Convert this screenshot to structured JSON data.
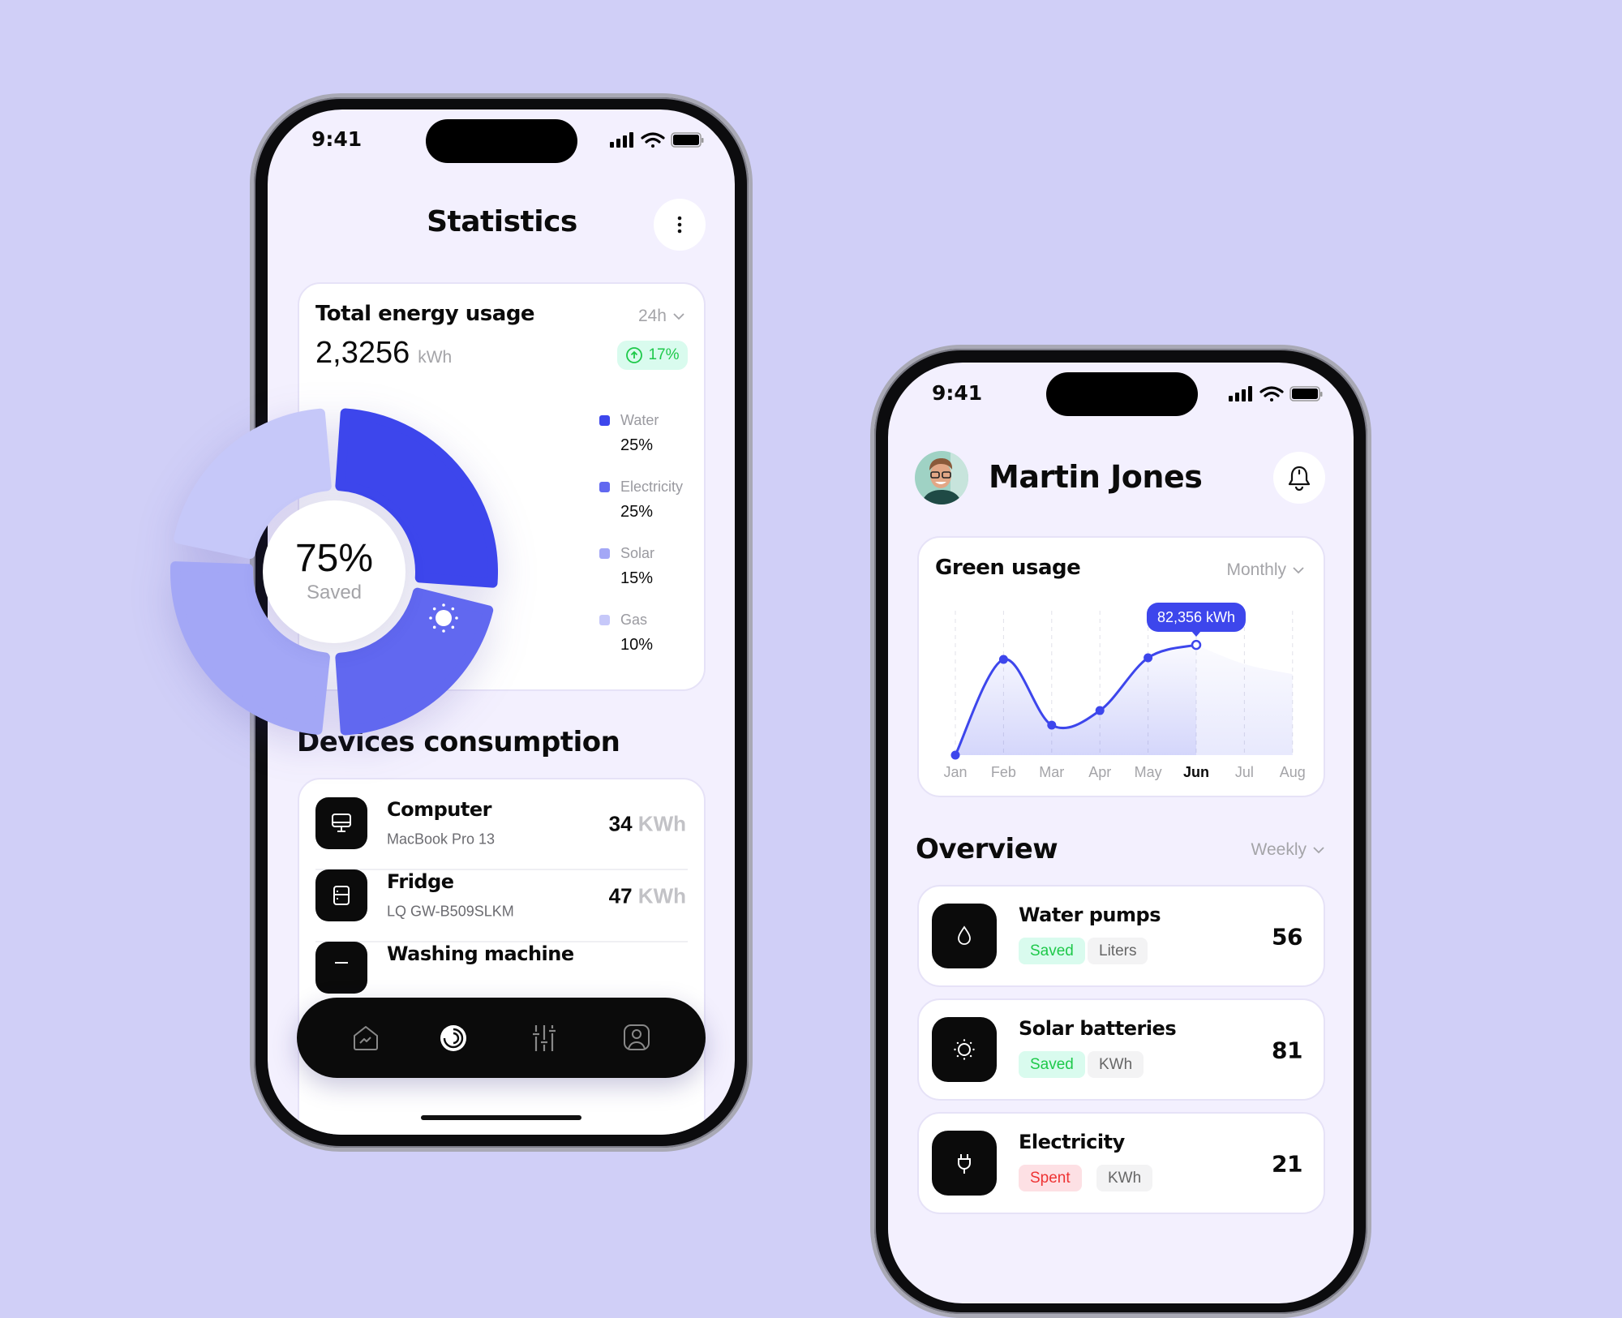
{
  "colors": {
    "background": "#d0cff7",
    "accent": "#3d46ec",
    "water": "#3d46ec",
    "electricity": "#6168f0",
    "solar": "#a3a7f6",
    "gas": "#c6c8f9",
    "saved": "#1ec94a",
    "spent": "#ee3333"
  },
  "statistics": {
    "status_time": "9:41",
    "title": "Statistics",
    "more_icon": "more-vertical-icon",
    "energy_card": {
      "title": "Total energy usage",
      "period": "24h",
      "value": "2,3256",
      "unit": "kWh",
      "change": "17%"
    },
    "donut": {
      "percent": "75%",
      "label": "Saved",
      "segments": [
        {
          "name": "Water",
          "value": "25%"
        },
        {
          "name": "Electricity",
          "value": "25%"
        },
        {
          "name": "Solar",
          "value": "15%"
        },
        {
          "name": "Gas",
          "value": "10%"
        }
      ]
    },
    "devices_title": "Devices consumption",
    "devices": [
      {
        "name": "Computer",
        "model": "MacBook Pro 13",
        "value": "34",
        "unit": "KWh",
        "icon": "monitor-icon"
      },
      {
        "name": "Fridge",
        "model": "LQ GW-B509SLKM",
        "value": "47",
        "unit": "KWh",
        "icon": "fridge-icon"
      },
      {
        "name": "Washing machine",
        "icon": "washing-machine-icon"
      }
    ],
    "nav": [
      {
        "icon": "home-chart-icon"
      },
      {
        "icon": "statistics-icon",
        "active": true
      },
      {
        "icon": "sliders-icon"
      },
      {
        "icon": "profile-icon"
      }
    ]
  },
  "home": {
    "status_time": "9:41",
    "user_name": "Martin Jones",
    "bell_icon": "bell-icon",
    "green_usage": {
      "title": "Green usage",
      "period": "Monthly",
      "tooltip": "82,356 kWh",
      "selected": "Jun"
    },
    "overview_title": "Overview",
    "overview_period": "Weekly",
    "overview": [
      {
        "name": "Water pumps",
        "status": "Saved",
        "unit": "Liters",
        "value": "56",
        "icon": "water-drop-icon"
      },
      {
        "name": "Solar batteries",
        "status": "Saved",
        "unit": "KWh",
        "value": "81",
        "icon": "sun-icon"
      },
      {
        "name": "Electricity",
        "status": "Spent",
        "unit": "KWh",
        "value": "21",
        "icon": "plug-icon"
      }
    ]
  },
  "chart_data": {
    "type": "area",
    "categories": [
      "Jan",
      "Feb",
      "Mar",
      "Apr",
      "May",
      "Jun",
      "Jul",
      "Aug"
    ],
    "values": [
      0,
      71500,
      22400,
      33300,
      72700,
      82356,
      68000,
      60500
    ],
    "projected_from": "Jul",
    "highlight": {
      "category": "Jun",
      "label": "82,356 kWh"
    },
    "ylim": [
      0,
      100000
    ],
    "grid": "vertical dashed",
    "xlabel": "",
    "ylabel": ""
  }
}
